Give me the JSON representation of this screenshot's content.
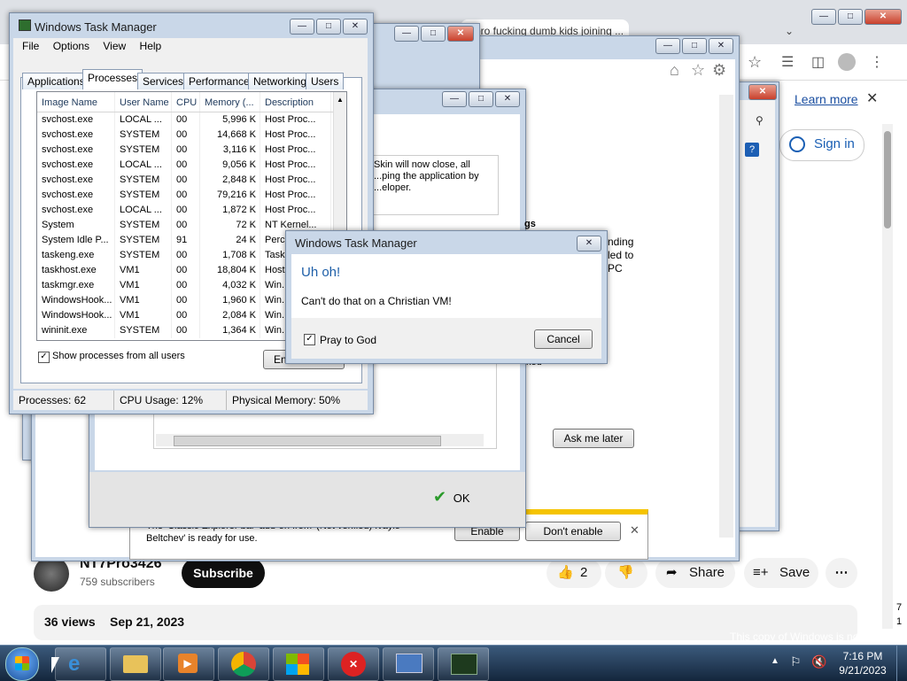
{
  "browser": {
    "tab_title": "bro fucking dumb kids joining ...",
    "learn_more": "Learn more",
    "sign_in": "Sign in"
  },
  "youtube": {
    "channel_name": "NT7Pro3426",
    "subscribers": "759 subscribers",
    "subscribe": "Subscribe",
    "likes": "2",
    "share": "Share",
    "save": "Save",
    "views": "36 views",
    "date": "Sep 21, 2023"
  },
  "ie_window": {
    "notification": "The 'Classic Explorer bar' add-on from '(Not verified) Ivaylo Beltchev' is ready for use.",
    "enable": "Enable",
    "dont_enable": "Don't enable"
  },
  "windowblinds": {
    "text": "Skin will now close, all ...ping the application by ...eloper.",
    "ok": "OK"
  },
  "update_dialog": {
    "partial_heading": "gs",
    "partial_lines": [
      "nding",
      "led to",
      "PC"
    ],
    "partial_text": "ked",
    "ask_later": "Ask me later"
  },
  "task_manager": {
    "title": "Windows Task Manager",
    "menu": [
      "File",
      "Options",
      "View",
      "Help"
    ],
    "tabs": [
      "Applications",
      "Processes",
      "Services",
      "Performance",
      "Networking",
      "Users"
    ],
    "columns": [
      "Image Name",
      "User Name",
      "CPU",
      "Memory (...",
      "Description"
    ],
    "rows": [
      [
        "svchost.exe",
        "LOCAL ...",
        "00",
        "5,996 K",
        "Host Proc..."
      ],
      [
        "svchost.exe",
        "SYSTEM",
        "00",
        "14,668 K",
        "Host Proc..."
      ],
      [
        "svchost.exe",
        "SYSTEM",
        "00",
        "3,116 K",
        "Host Proc..."
      ],
      [
        "svchost.exe",
        "LOCAL ...",
        "00",
        "9,056 K",
        "Host Proc..."
      ],
      [
        "svchost.exe",
        "SYSTEM",
        "00",
        "2,848 K",
        "Host Proc..."
      ],
      [
        "svchost.exe",
        "SYSTEM",
        "00",
        "79,216 K",
        "Host Proc..."
      ],
      [
        "svchost.exe",
        "LOCAL ...",
        "00",
        "1,872 K",
        "Host Proc..."
      ],
      [
        "System",
        "SYSTEM",
        "00",
        "72 K",
        "NT Kernel..."
      ],
      [
        "System Idle P...",
        "SYSTEM",
        "91",
        "24 K",
        "Perc..."
      ],
      [
        "taskeng.exe",
        "SYSTEM",
        "00",
        "1,708 K",
        "Task..."
      ],
      [
        "taskhost.exe",
        "VM1",
        "00",
        "18,804 K",
        "Host..."
      ],
      [
        "taskmgr.exe",
        "VM1",
        "00",
        "4,032 K",
        "Win..."
      ],
      [
        "WindowsHook...",
        "VM1",
        "00",
        "1,960 K",
        "Win..."
      ],
      [
        "WindowsHook...",
        "VM1",
        "00",
        "2,084 K",
        "Win..."
      ],
      [
        "wininit.exe",
        "SYSTEM",
        "00",
        "1,364 K",
        "Win..."
      ]
    ],
    "show_all": "Show processes from all users",
    "end_process": "End Process",
    "status": {
      "processes": "Processes: 62",
      "cpu": "CPU Usage: 12%",
      "memory": "Physical Memory: 50%"
    }
  },
  "error_dialog": {
    "title": "Windows Task Manager",
    "heading": "Uh oh!",
    "message": "Can't do that on a Christian VM!",
    "checkbox_label": "Pray to God",
    "checkbox_checked": true,
    "cancel": "Cancel"
  },
  "taskbar": {
    "time": "7:16 PM",
    "date": "9/21/2023",
    "genuine": "This copy of Windows is not genuine",
    "build_partial": [
      "7",
      "1"
    ]
  },
  "colors": {
    "heading_blue": "#1e5fa8",
    "youtube_dark": "#0f0f0f",
    "link_blue": "#1a4ea0"
  }
}
